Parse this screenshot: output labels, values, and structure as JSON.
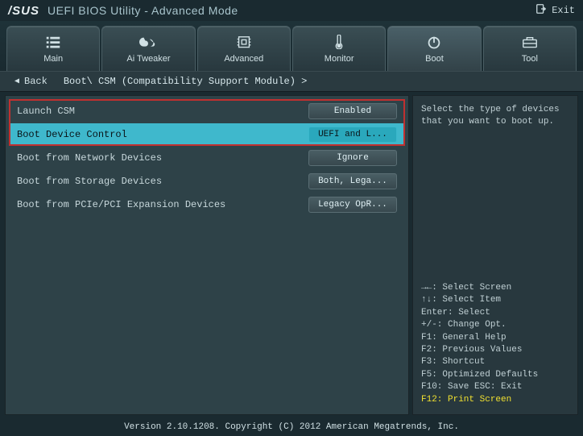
{
  "brand": "/SUS",
  "title": "UEFI BIOS Utility - Advanced Mode",
  "exit_label": "Exit",
  "tabs": [
    {
      "label": "Main"
    },
    {
      "label": "Ai Tweaker"
    },
    {
      "label": "Advanced"
    },
    {
      "label": "Monitor"
    },
    {
      "label": "Boot"
    },
    {
      "label": "Tool"
    }
  ],
  "back_label": "Back",
  "breadcrumb": "Boot\\ CSM (Compatibility Support Module) >",
  "options": [
    {
      "label": "Launch CSM",
      "value": "Enabled"
    },
    {
      "label": "Boot Device Control",
      "value": "UEFI and L..."
    },
    {
      "label": "Boot from Network Devices",
      "value": "Ignore"
    },
    {
      "label": "Boot from Storage Devices",
      "value": "Both, Lega..."
    },
    {
      "label": "Boot from PCIe/PCI Expansion Devices",
      "value": "Legacy OpR..."
    }
  ],
  "help_text": "Select the type of devices that you want to boot up.",
  "keys": {
    "l0": "→←: Select Screen",
    "l1": "↑↓: Select Item",
    "l2": "Enter: Select",
    "l3": "+/-: Change Opt.",
    "l4": "F1: General Help",
    "l5": "F2: Previous Values",
    "l6": "F3: Shortcut",
    "l7": "F5: Optimized Defaults",
    "l8": "F10: Save  ESC: Exit",
    "l9": "F12: Print Screen"
  },
  "footer": "Version 2.10.1208. Copyright (C) 2012 American Megatrends, Inc."
}
